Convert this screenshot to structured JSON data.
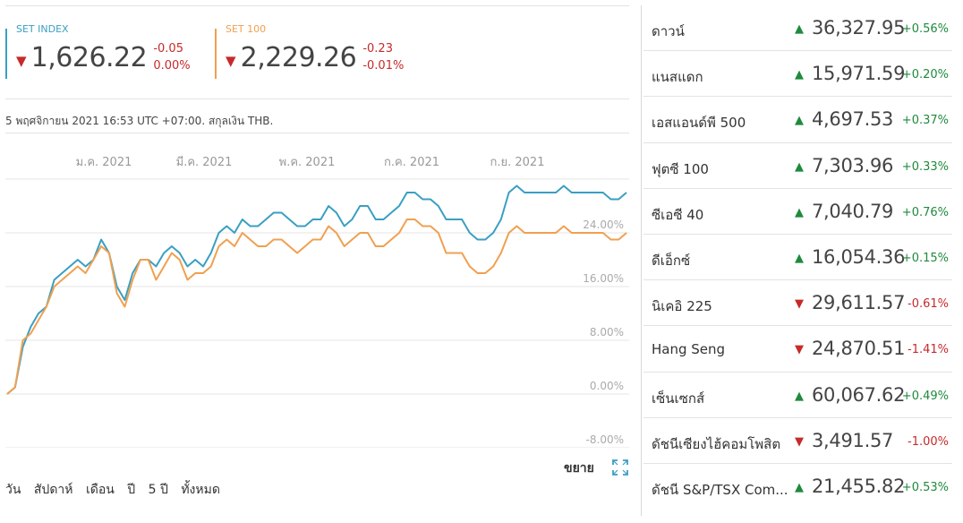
{
  "quotes": [
    {
      "name": "SET INDEX",
      "value": "1,626.22",
      "change": "-0.05",
      "change_pct": "0.00%",
      "direction": "down",
      "color": "#3a9fc2"
    },
    {
      "name": "SET 100",
      "value": "2,229.26",
      "change": "-0.23",
      "change_pct": "-0.01%",
      "direction": "down",
      "color": "#f0a050"
    }
  ],
  "timestamp": "5 พฤศจิกายน 2021 16:53 UTC +07:00. สกุลเงิน THB.",
  "chart_data": {
    "type": "line",
    "x_labels": [
      "ม.ค. 2021",
      "มี.ค. 2021",
      "พ.ค. 2021",
      "ก.ค. 2021",
      "ก.ย. 2021"
    ],
    "y_ticks": [
      "24.00%",
      "16.00%",
      "8.00%",
      "0.00%",
      "-8.00%"
    ],
    "ylim": [
      -8,
      32
    ],
    "series": [
      {
        "name": "SET INDEX",
        "color": "#3a9fc2",
        "values": [
          0,
          1,
          7,
          10,
          12,
          13,
          17,
          18,
          19,
          20,
          19,
          20,
          23,
          21,
          16,
          14,
          18,
          20,
          20,
          19,
          21,
          22,
          21,
          19,
          20,
          19,
          21,
          24,
          25,
          24,
          26,
          25,
          25,
          26,
          27,
          27,
          26,
          25,
          25,
          26,
          26,
          28,
          27,
          25,
          26,
          28,
          28,
          26,
          26,
          27,
          28,
          30,
          30,
          29,
          29,
          28,
          26,
          26,
          26,
          24,
          23,
          23,
          24,
          26,
          30,
          31,
          30,
          30,
          30,
          30,
          30,
          31,
          30,
          30,
          30,
          30,
          30,
          29,
          29,
          30
        ]
      },
      {
        "name": "SET 100",
        "color": "#f0a050",
        "values": [
          0,
          1,
          8,
          9,
          11,
          13,
          16,
          17,
          18,
          19,
          18,
          20,
          22,
          21,
          15,
          13,
          17,
          20,
          20,
          17,
          19,
          21,
          20,
          17,
          18,
          18,
          19,
          22,
          23,
          22,
          24,
          23,
          22,
          22,
          23,
          23,
          22,
          21,
          22,
          23,
          23,
          25,
          24,
          22,
          23,
          24,
          24,
          22,
          22,
          23,
          24,
          26,
          26,
          25,
          25,
          24,
          21,
          21,
          21,
          19,
          18,
          18,
          19,
          21,
          24,
          25,
          24,
          24,
          24,
          24,
          24,
          25,
          24,
          24,
          24,
          24,
          24,
          23,
          23,
          24
        ]
      }
    ]
  },
  "expand_label": "ขยาย",
  "periods": [
    "วัน",
    "สัปดาห์",
    "เดือน",
    "ปี",
    "5 ปี",
    "ทั้งหมด"
  ],
  "indices": [
    {
      "name": "ดาวน์",
      "value": "36,327.95",
      "change_pct": "+0.56%",
      "direction": "up"
    },
    {
      "name": "แนสแดก",
      "value": "15,971.59",
      "change_pct": "+0.20%",
      "direction": "up"
    },
    {
      "name": "เอสแอนด์พี 500",
      "value": "4,697.53",
      "change_pct": "+0.37%",
      "direction": "up"
    },
    {
      "name": "ฟุตซี 100",
      "value": "7,303.96",
      "change_pct": "+0.33%",
      "direction": "up"
    },
    {
      "name": "ซีเอซี 40",
      "value": "7,040.79",
      "change_pct": "+0.76%",
      "direction": "up"
    },
    {
      "name": "ดีเอ็กซ์",
      "value": "16,054.36",
      "change_pct": "+0.15%",
      "direction": "up"
    },
    {
      "name": "นิเคอิ 225",
      "value": "29,611.57",
      "change_pct": "-0.61%",
      "direction": "down"
    },
    {
      "name": "Hang Seng",
      "value": "24,870.51",
      "change_pct": "-1.41%",
      "direction": "down"
    },
    {
      "name": "เซ็นเซกส์",
      "value": "60,067.62",
      "change_pct": "+0.49%",
      "direction": "up"
    },
    {
      "name": "ดัชนีเซียงไฮ้คอมโพสิต",
      "value": "3,491.57",
      "change_pct": "-1.00%",
      "direction": "down"
    },
    {
      "name": "ดัชนี S&P/TSX Com...",
      "value": "21,455.82",
      "change_pct": "+0.53%",
      "direction": "up"
    }
  ]
}
